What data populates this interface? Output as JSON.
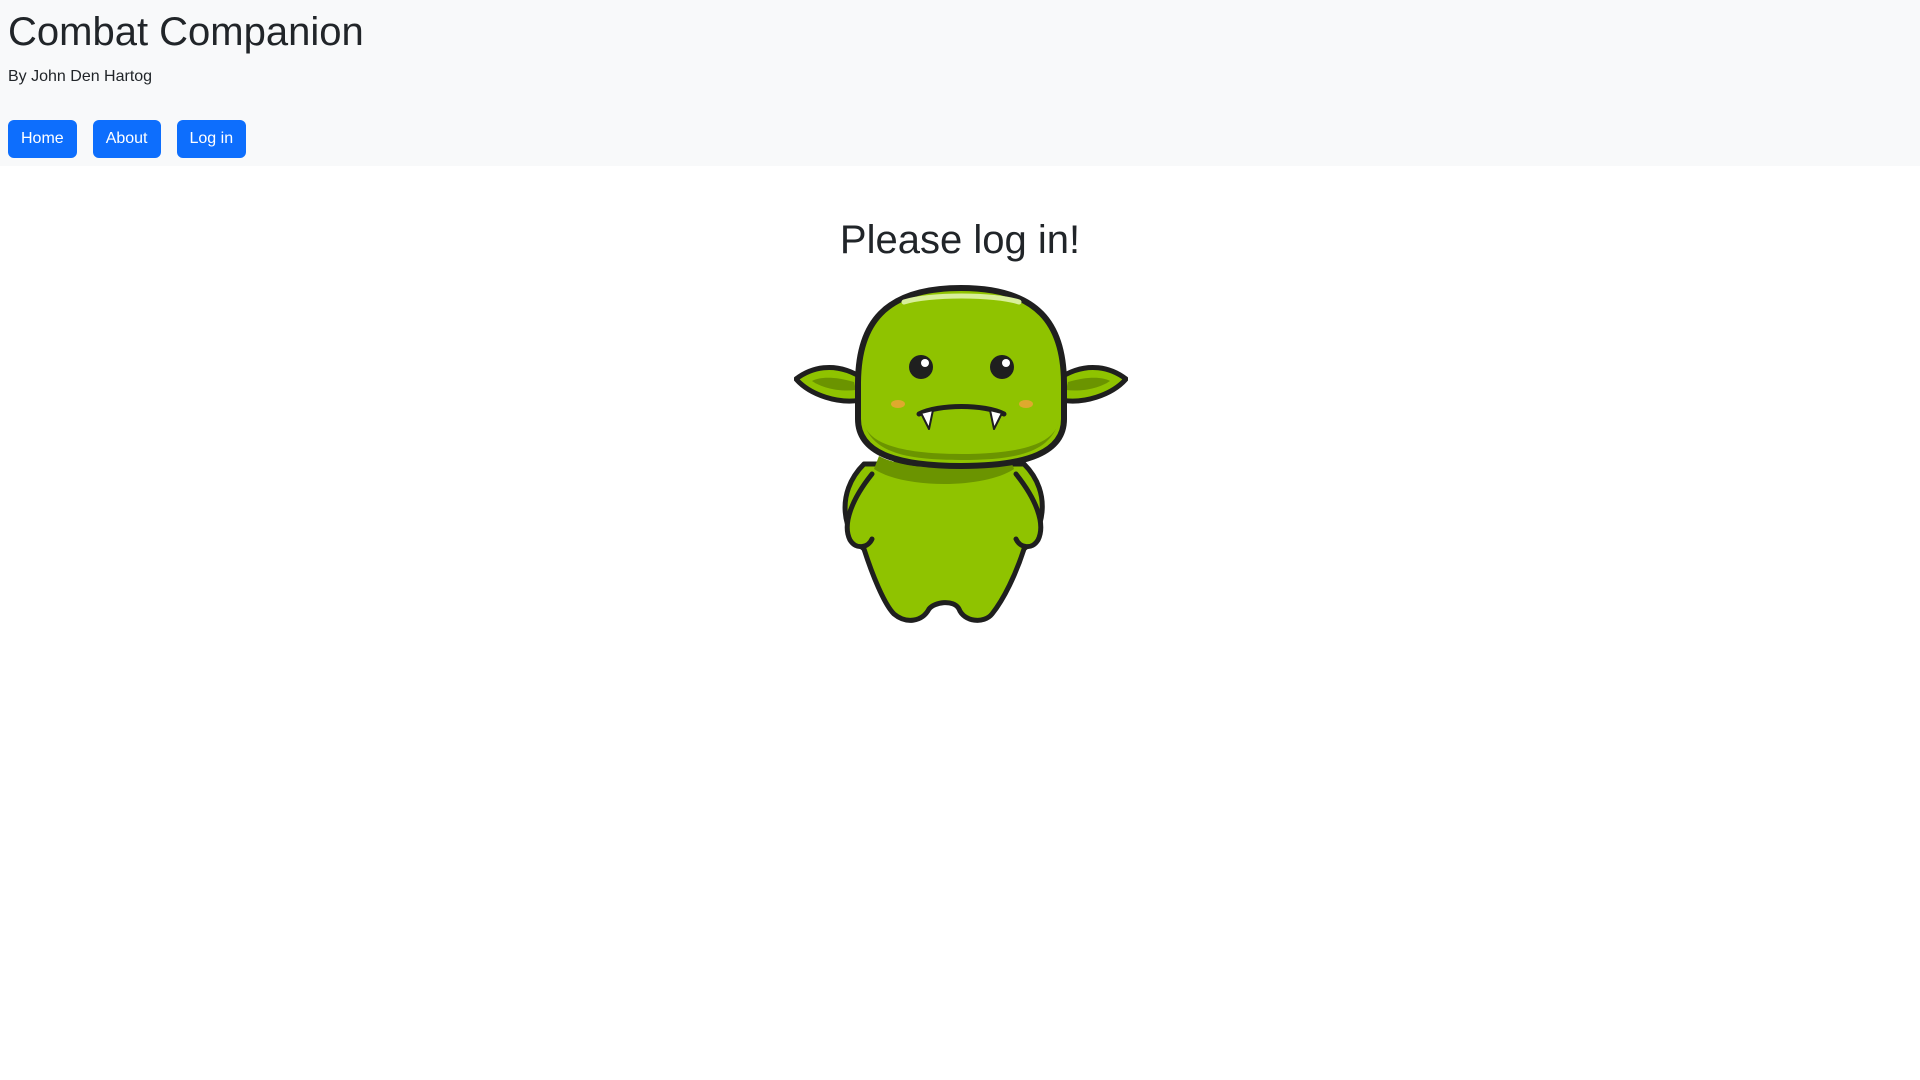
{
  "header": {
    "title": "Combat Companion",
    "subtitle": "By John Den Hartog"
  },
  "nav": {
    "items": [
      {
        "label": "Home"
      },
      {
        "label": "About"
      },
      {
        "label": "Log in"
      }
    ]
  },
  "main": {
    "heading": "Please log in!",
    "illustration": "goblin-mascot-icon"
  },
  "colors": {
    "header_bg": "#f8f9fa",
    "button_bg": "#0d6efd",
    "text": "#212529",
    "goblin_green": "#8fc300"
  }
}
